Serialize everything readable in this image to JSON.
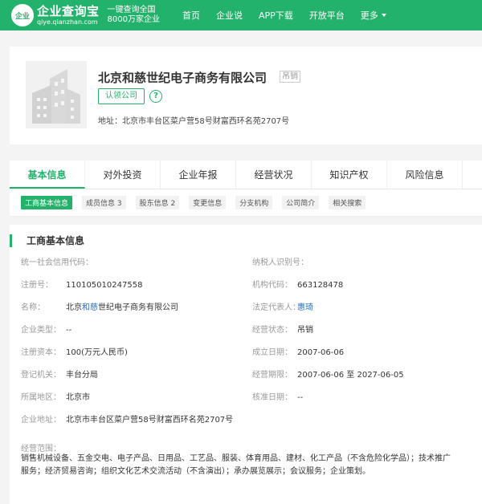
{
  "header": {
    "logo_badge": "企业",
    "logo_name": "企业查询宝",
    "logo_domain": "qiye.qianzhan.com",
    "slogan_line1": "一键查询全国",
    "slogan_line2": "8000万家企业",
    "nav": [
      "首页",
      "企业说",
      "APP下载",
      "开放平台",
      "更多"
    ]
  },
  "company": {
    "name": "北京和慈世纪电子商务有限公司",
    "status": "吊销",
    "claim_label": "认领公司",
    "help_glyph": "?",
    "address_label": "地址：",
    "address": "北京市丰台区菜户营58号财富西环名苑2707号"
  },
  "tabs": [
    "基本信息",
    "对外投资",
    "企业年报",
    "经营状况",
    "知识产权",
    "风险信息"
  ],
  "subtabs": [
    "工商基本信息",
    "成员信息 3",
    "股东信息 2",
    "变更信息",
    "分支机构",
    "公司简介",
    "相关搜索"
  ],
  "section_title": "工商基本信息",
  "fields": {
    "credit_code_label": "统一社会信用代码：",
    "credit_code": "",
    "taxpayer_label": "纳税人识别号：",
    "taxpayer": "",
    "reg_no_label": "注册号：",
    "reg_no": "110105010247558",
    "org_code_label": "机构代码：",
    "org_code": "663128478",
    "name_label": "名称：",
    "name_pre": "北京",
    "name_link": "和慈",
    "name_post": "世纪电子商务有限公司",
    "legal_rep_label": "法定代表人：",
    "legal_rep": "惠琦",
    "type_label": "企业类型：",
    "type": "--",
    "op_status_label": "经营状态：",
    "op_status": "吊销",
    "capital_label": "注册资本：",
    "capital": "100(万元人民币)",
    "founded_label": "成立日期：",
    "founded": "2007-06-06",
    "authority_label": "登记机关：",
    "authority": "丰台分局",
    "term_label": "经营期限：",
    "term": "2007-06-06 至 2027-06-05",
    "region_label": "所属地区：",
    "region": "北京市",
    "approval_label": "核准日期：",
    "approval": "--",
    "address_label": "企业地址：",
    "address": "北京市丰台区菜户营58号财富西环名苑2707号",
    "scope_label": "经营范围：",
    "scope_line1": "销售机械设备、五金交电、电子产品、日用品、工艺品、服装、体育用品、建材、化工产品（不含危险化学品）；技术推广",
    "scope_line2": "服务；经济贸易咨询；组织文化艺术交流活动（不含演出）；承办展览展示；会议服务；企业策划。"
  },
  "colors": {
    "brand": "#23b26b",
    "link": "#2b6fbf"
  }
}
